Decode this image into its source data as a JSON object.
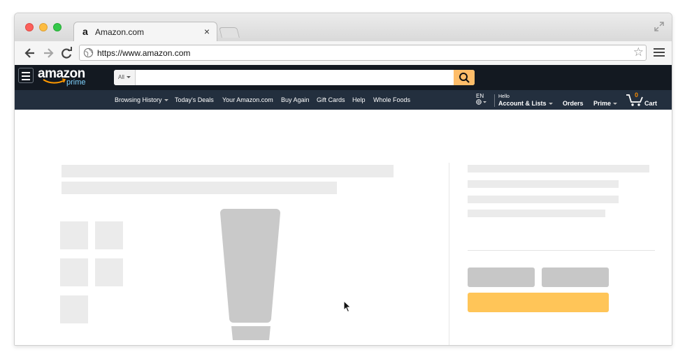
{
  "browser": {
    "tab_title": "Amazon.com",
    "tab_favicon": "a",
    "tab_close": "×",
    "url": "https://www.amazon.com",
    "bookmark_star": "☆"
  },
  "amazon": {
    "logo_text": "amazon",
    "logo_prime": "prime",
    "search_category": "All",
    "subnav": [
      {
        "label": "Browsing History",
        "dropdown": true
      },
      {
        "label": "Today's Deals",
        "dropdown": false
      },
      {
        "label": "Your Amazon.com",
        "dropdown": false
      },
      {
        "label": "Buy Again",
        "dropdown": false
      },
      {
        "label": "Gift Cards",
        "dropdown": false
      },
      {
        "label": "Help",
        "dropdown": false
      },
      {
        "label": "Whole Foods",
        "dropdown": false
      }
    ],
    "language": "EN",
    "account_hello": "Hello",
    "account_label": "Account & Lists",
    "orders": "Orders",
    "prime": "Prime",
    "cart_count": "0",
    "cart_label": "Cart"
  },
  "colors": {
    "nav_top": "#131921",
    "nav_sub": "#232f3e",
    "search_button": "#febd69",
    "placeholder": "#ebebeb",
    "buy_button": "#ffc558"
  }
}
